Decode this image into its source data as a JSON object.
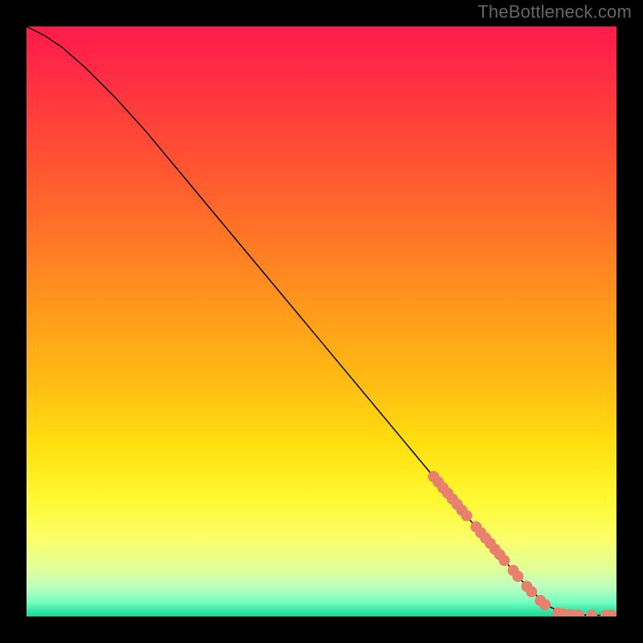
{
  "watermark": "TheBottleneck.com",
  "chart_data": {
    "type": "line",
    "title": "",
    "xlabel": "",
    "ylabel": "",
    "xlim": [
      0,
      100
    ],
    "ylim": [
      0,
      100
    ],
    "grid": false,
    "background_gradient": {
      "stops": [
        {
          "offset": 0.0,
          "color": "#ff1a4a"
        },
        {
          "offset": 0.07,
          "color": "#ff2a46"
        },
        {
          "offset": 0.16,
          "color": "#ff4139"
        },
        {
          "offset": 0.25,
          "color": "#ff5830"
        },
        {
          "offset": 0.34,
          "color": "#ff7128"
        },
        {
          "offset": 0.43,
          "color": "#ff8b20"
        },
        {
          "offset": 0.52,
          "color": "#ffa518"
        },
        {
          "offset": 0.61,
          "color": "#ffbe12"
        },
        {
          "offset": 0.71,
          "color": "#ffe010"
        },
        {
          "offset": 0.8,
          "color": "#fff830"
        },
        {
          "offset": 0.87,
          "color": "#fbff6a"
        },
        {
          "offset": 0.92,
          "color": "#e0ff9a"
        },
        {
          "offset": 0.95,
          "color": "#baffbe"
        },
        {
          "offset": 0.975,
          "color": "#7affc0"
        },
        {
          "offset": 0.99,
          "color": "#34e8a8"
        },
        {
          "offset": 1.0,
          "color": "#18d692"
        }
      ]
    },
    "series": [
      {
        "name": "curve",
        "type": "line",
        "color": "#000000",
        "width": 1.5,
        "points": [
          {
            "x": 0,
            "y": 100
          },
          {
            "x": 3,
            "y": 98.5
          },
          {
            "x": 6,
            "y": 96.5
          },
          {
            "x": 10,
            "y": 93
          },
          {
            "x": 15,
            "y": 88
          },
          {
            "x": 20,
            "y": 82.5
          },
          {
            "x": 30,
            "y": 70.5
          },
          {
            "x": 40,
            "y": 58.5
          },
          {
            "x": 50,
            "y": 46.5
          },
          {
            "x": 60,
            "y": 34.5
          },
          {
            "x": 70,
            "y": 22.5
          },
          {
            "x": 78,
            "y": 13
          },
          {
            "x": 84,
            "y": 6
          },
          {
            "x": 88,
            "y": 2
          },
          {
            "x": 91,
            "y": 0.5
          },
          {
            "x": 95,
            "y": 0.2
          },
          {
            "x": 100,
            "y": 0.2
          }
        ]
      },
      {
        "name": "markers",
        "type": "scatter",
        "color": "#e8806e",
        "radius": 7,
        "points": [
          {
            "x": 69.0,
            "y": 23.7
          },
          {
            "x": 69.8,
            "y": 22.8
          },
          {
            "x": 70.6,
            "y": 21.8
          },
          {
            "x": 71.4,
            "y": 20.9
          },
          {
            "x": 72.2,
            "y": 19.9
          },
          {
            "x": 73.0,
            "y": 19.0
          },
          {
            "x": 73.8,
            "y": 18.0
          },
          {
            "x": 74.6,
            "y": 17.1
          },
          {
            "x": 76.2,
            "y": 15.2
          },
          {
            "x": 77.0,
            "y": 14.2
          },
          {
            "x": 77.8,
            "y": 13.3
          },
          {
            "x": 78.6,
            "y": 12.4
          },
          {
            "x": 79.4,
            "y": 11.4
          },
          {
            "x": 80.2,
            "y": 10.5
          },
          {
            "x": 81.0,
            "y": 9.5
          },
          {
            "x": 82.5,
            "y": 7.8
          },
          {
            "x": 83.3,
            "y": 6.8
          },
          {
            "x": 84.8,
            "y": 5.1
          },
          {
            "x": 85.6,
            "y": 4.2
          },
          {
            "x": 87.1,
            "y": 2.7
          },
          {
            "x": 87.9,
            "y": 2.0
          },
          {
            "x": 90.1,
            "y": 0.6
          },
          {
            "x": 91.0,
            "y": 0.4
          },
          {
            "x": 92.0,
            "y": 0.3
          },
          {
            "x": 92.8,
            "y": 0.2
          },
          {
            "x": 93.6,
            "y": 0.2
          },
          {
            "x": 95.8,
            "y": 0.2
          },
          {
            "x": 98.2,
            "y": 0.2
          },
          {
            "x": 99.1,
            "y": 0.2
          }
        ]
      }
    ]
  }
}
